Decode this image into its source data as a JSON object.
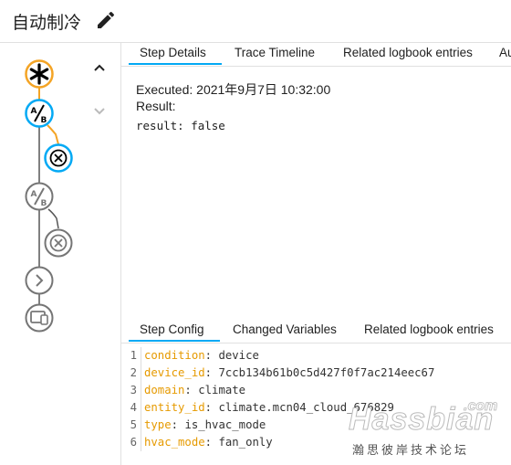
{
  "header": {
    "title": "自动制冷"
  },
  "top_tabs": [
    "Step Details",
    "Trace Timeline",
    "Related logbook entries",
    "Au"
  ],
  "step_details": {
    "executed": "Executed: 2021年9月7日 10:32:00",
    "result_label": "Result:",
    "result_value": "result: false"
  },
  "bottom_tabs": [
    "Step Config",
    "Changed Variables",
    "Related logbook entries"
  ],
  "config_lines": [
    {
      "num": "1",
      "key": "condition",
      "value": "device"
    },
    {
      "num": "2",
      "key": "device_id",
      "value": "7ccb134b61b0c5d427f0f7ac214eec67"
    },
    {
      "num": "3",
      "key": "domain",
      "value": "climate"
    },
    {
      "num": "4",
      "key": "entity_id",
      "value": "climate.mcn04_cloud_676829"
    },
    {
      "num": "5",
      "key": "type",
      "value": "is_hvac_mode"
    },
    {
      "num": "6",
      "key": "hvac_mode",
      "value": "fan_only"
    }
  ],
  "watermark": {
    "logo": "Hassbian",
    "com": ".com",
    "sub": "瀚思彼岸技术论坛"
  },
  "colors": {
    "accent": "#03a9f4",
    "active_path": "#f4a425",
    "inactive": "#757575",
    "key": "#e69a00"
  },
  "icons": {
    "trigger": "asterisk-icon",
    "condition": "ab-condition-icon",
    "stop": "x-circle-icon",
    "next": "chevron-right-icon",
    "device": "device-action-icon",
    "edit": "pencil-icon",
    "nav_up": "chevron-up-icon",
    "nav_down": "chevron-down-icon"
  }
}
